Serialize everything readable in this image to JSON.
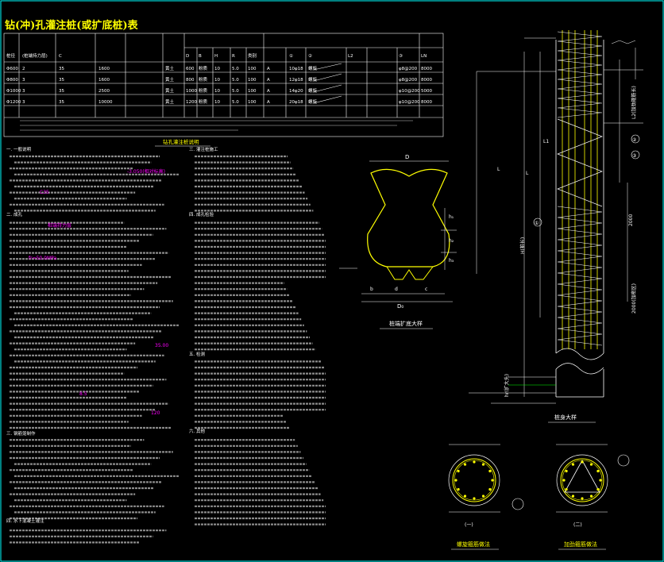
{
  "title": "钻(冲)孔灌注桩(或扩底桩)表",
  "table": {
    "headers": [
      "桩径",
      "(桩端持力层)",
      "C",
      "",
      "",
      "",
      "D",
      "B",
      "H",
      "R",
      "类别",
      "",
      "①",
      "②",
      "L2",
      "",
      "③",
      "LN"
    ],
    "rows": [
      [
        "Φ600",
        "2",
        "35",
        "1600",
        "",
        "黄土",
        "600",
        "粉质",
        "10",
        "5.0",
        "100",
        "A",
        "10φ18",
        "螺旋",
        "",
        "",
        "φ8@200",
        "8000"
      ],
      [
        "Φ800",
        "3",
        "35",
        "1600",
        "",
        "黄土",
        "800",
        "粉质",
        "10",
        "5.0",
        "100",
        "A",
        "12φ18",
        "螺旋",
        "",
        "",
        "φ8@200",
        "8000"
      ],
      [
        "Φ1000",
        "3",
        "35",
        "2500",
        "",
        "黄土",
        "1000",
        "粉质",
        "10",
        "5.0",
        "100",
        "A",
        "14φ20",
        "螺旋",
        "",
        "",
        "φ10@200",
        "5000"
      ],
      [
        "Φ1200",
        "3",
        "35",
        "10000",
        "",
        "黄土",
        "1200",
        "粉质",
        "10",
        "5.0",
        "100",
        "A",
        "20φ18",
        "螺旋",
        "",
        "",
        "φ10@200",
        "8000"
      ]
    ]
  },
  "notes_title": "钻孔灌注桩说明",
  "left_col_headings": [
    "一. 一般说明",
    "二. 成孔",
    "三. 钢筋笼制作",
    "四. 水下混凝土灌注"
  ],
  "mid_col_headings": [
    "三. 灌注桩施工",
    "四. 成孔检验",
    "五. 检测",
    "六. 其他"
  ],
  "magenta_texts": [
    "-3.050(相对标高)",
    "C35",
    "桩端持力层",
    "fr=50.0MPa",
    "35.00",
    "8.5",
    "120"
  ],
  "diagram1_caption": "桩端扩底大样",
  "diagram2_caption": "桩身大样",
  "section1_caption": "螺旋箍筋做法",
  "section2_caption": "加劲箍筋做法",
  "section_labels": [
    "(一)",
    "(二)"
  ],
  "dim_labels": {
    "D": "D",
    "D0": "D₀",
    "d": "d",
    "h1": "h₁",
    "h2": "h₂",
    "h3": "h₃",
    "b": "b",
    "c": "c",
    "L": "L",
    "L1": "L1",
    "L2": "L2(加劲箍筋长)",
    "H": "H(桩长)",
    "h2000": "2000",
    "h2000b": "2000(加密区)",
    "hr": "hr(扩大头)",
    "circ": "(-1)"
  },
  "colors": {
    "bg": "#000000",
    "line": "#ffffff",
    "yellow": "#ffff00",
    "magenta": "#ff00ff",
    "cyan": "#00ffff",
    "green": "#00ff00"
  }
}
